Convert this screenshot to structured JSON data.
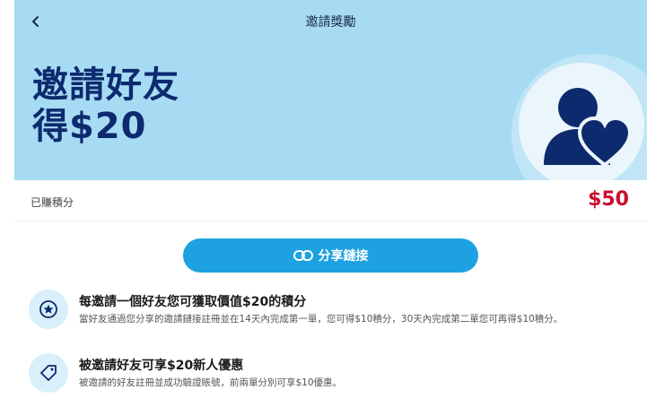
{
  "header": {
    "title": "邀請獎勵",
    "back_icon": "chevron-left-icon"
  },
  "hero": {
    "headline_line1": "邀請好友",
    "headline_line2": "得$20",
    "background_color": "#a6dbf3",
    "headline_color": "#0d2a6e",
    "illustration_icon": "user-heart-icon"
  },
  "points": {
    "label": "已賺積分",
    "value": "$50",
    "value_color": "#c8102e"
  },
  "share_button": {
    "label": "分享鏈接",
    "icon": "link-icon",
    "color": "#1da1e0"
  },
  "benefits": [
    {
      "icon": "star-badge-icon",
      "title": "每邀請一個好友您可獲取價值$20的積分",
      "description": "當好友通過您分享的邀請鏈接註冊並在14天內完成第一單，您可得$10積分，30天內完成第二單您可再得$10積分。"
    },
    {
      "icon": "tag-icon",
      "title": "被邀請好友可享$20新人優惠",
      "description": "被邀請的好友註冊並成功驗證賬號，前兩單分別可享$10優惠。"
    }
  ]
}
